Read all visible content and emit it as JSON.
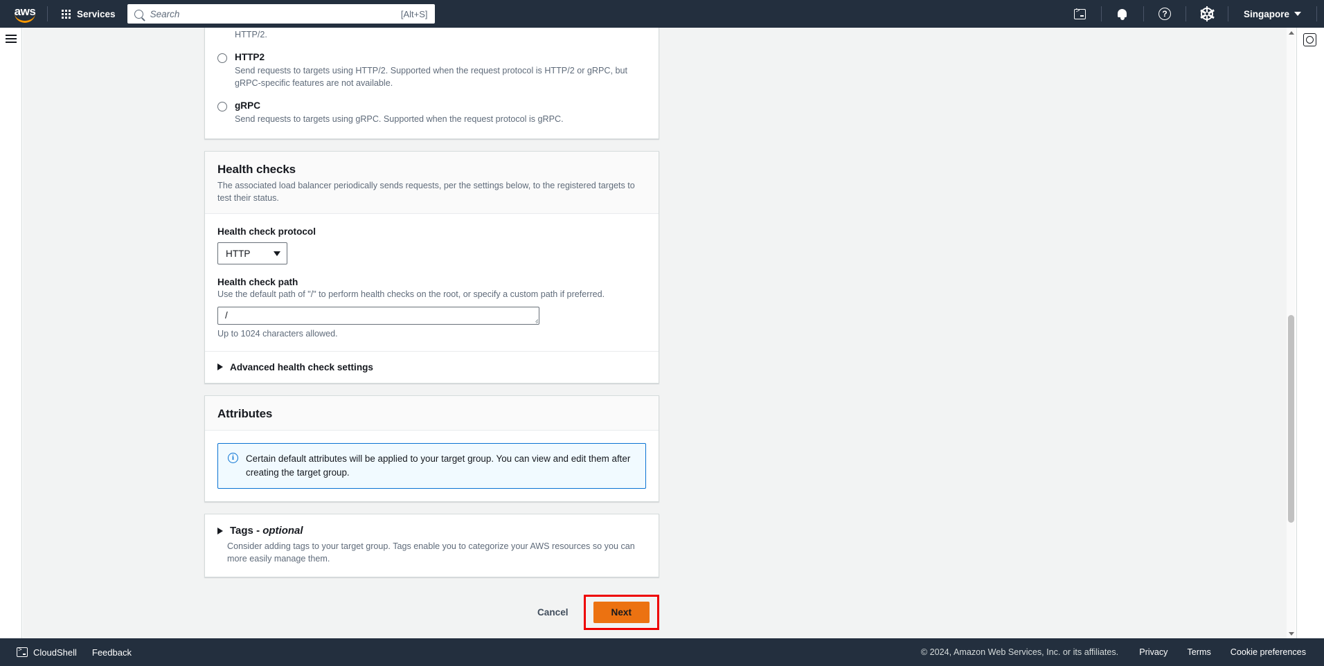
{
  "topnav": {
    "logo_text": "aws",
    "logo_name": "aws-logo",
    "services_label": "Services",
    "search": {
      "placeholder": "Search",
      "shortcut": "[Alt+S]"
    },
    "cloudshell_icon": "cloudshell-icon",
    "notifications_icon": "bell-icon",
    "help_icon": "question-circle-icon",
    "settings_icon": "gear-icon",
    "region_label": "Singapore"
  },
  "protocol_card": {
    "orphan_text": "HTTP/2.",
    "options": [
      {
        "label": "HTTP2",
        "description": "Send requests to targets using HTTP/2. Supported when the request protocol is HTTP/2 or gRPC, but gRPC-specific features are not available.",
        "selected": false
      },
      {
        "label": "gRPC",
        "description": "Send requests to targets using gRPC. Supported when the request protocol is gRPC.",
        "selected": false
      }
    ]
  },
  "health_checks": {
    "title": "Health checks",
    "description": "The associated load balancer periodically sends requests, per the settings below, to the registered targets to test their status.",
    "protocol_label": "Health check protocol",
    "protocol_value": "HTTP",
    "path_label": "Health check path",
    "path_hint": "Use the default path of \"/\" to perform health checks on the root, or specify a custom path if preferred.",
    "path_value": "/",
    "path_below_hint": "Up to 1024 characters allowed.",
    "advanced_label": "Advanced health check settings"
  },
  "attributes": {
    "title": "Attributes",
    "alert_text": "Certain default attributes will be applied to your target group. You can view and edit them after creating the target group.",
    "alert_icon": "info-circle-icon"
  },
  "tags": {
    "label_main": "Tags - ",
    "label_optional": "optional",
    "description": "Consider adding tags to your target group. Tags enable you to categorize your AWS resources so you can more easily manage them."
  },
  "actions": {
    "cancel_label": "Cancel",
    "next_label": "Next",
    "highlight_color": "#ee0000",
    "primary_color": "#ec7211"
  },
  "bottombar": {
    "cloudshell_label": "CloudShell",
    "feedback_label": "Feedback",
    "copyright": "© 2024, Amazon Web Services, Inc. or its affiliates.",
    "privacy_label": "Privacy",
    "terms_label": "Terms",
    "cookie_label": "Cookie preferences"
  }
}
